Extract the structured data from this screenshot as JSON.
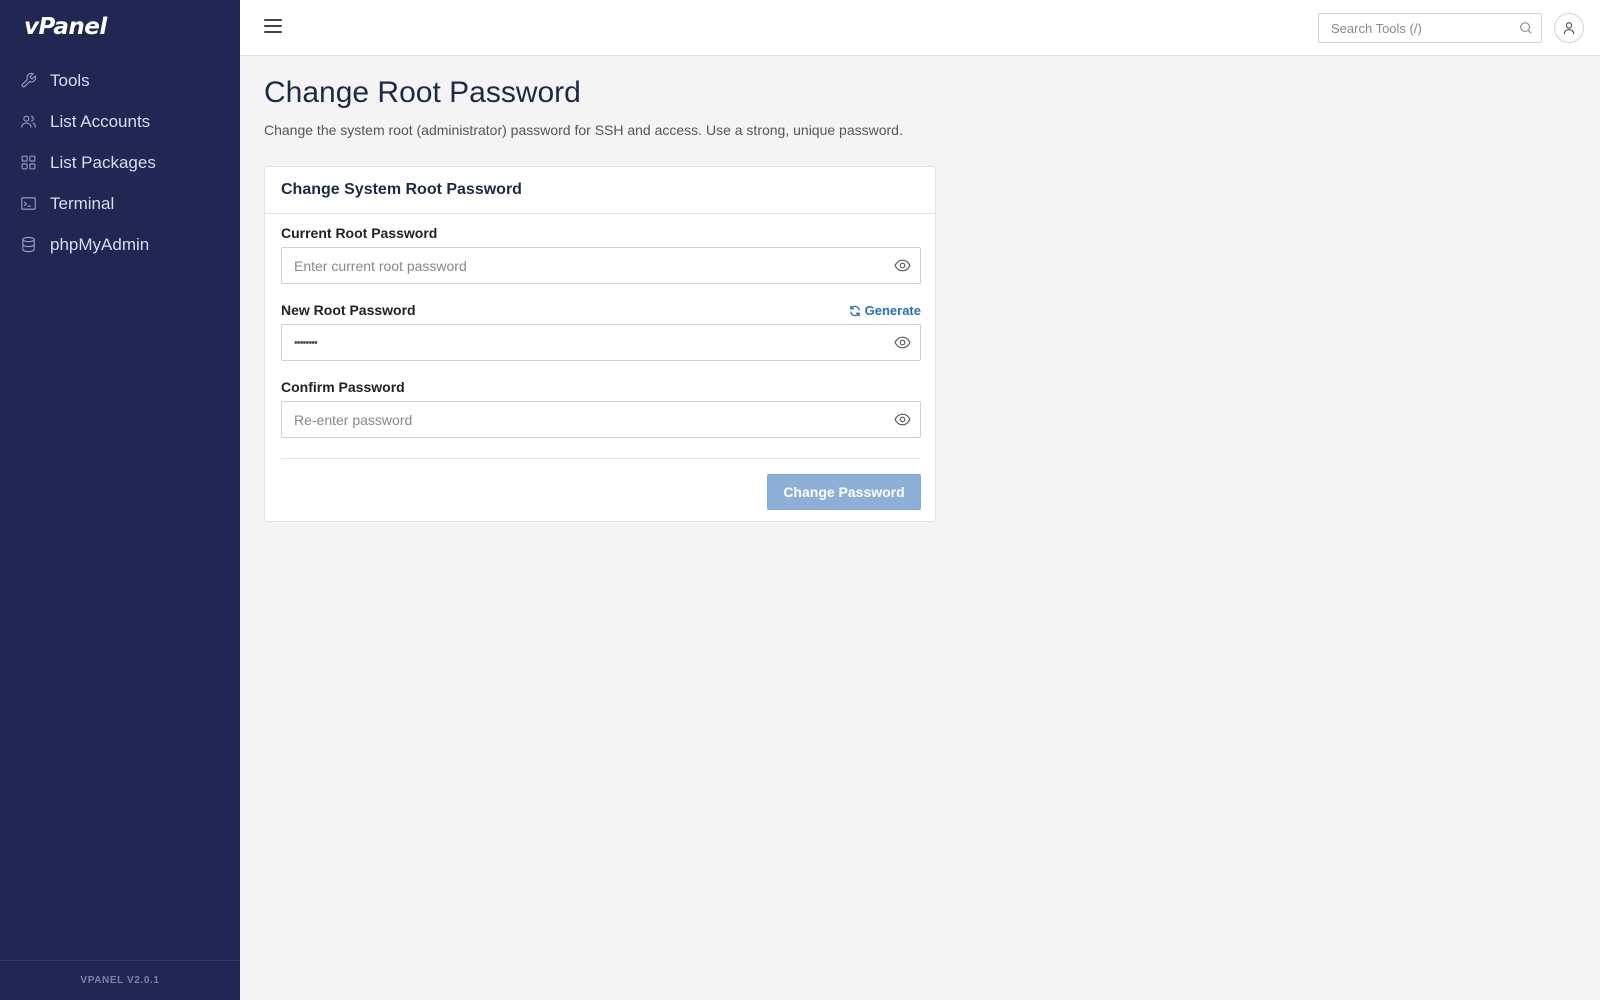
{
  "app": {
    "logo": "vPanel",
    "version": "VPANEL V2.0.1"
  },
  "sidebar": {
    "items": [
      {
        "label": "Tools",
        "icon": "wrench-icon"
      },
      {
        "label": "List Accounts",
        "icon": "users-icon"
      },
      {
        "label": "List Packages",
        "icon": "grid-icon"
      },
      {
        "label": "Terminal",
        "icon": "terminal-icon"
      },
      {
        "label": "phpMyAdmin",
        "icon": "database-icon"
      }
    ]
  },
  "header": {
    "search_placeholder": "Search Tools (/)"
  },
  "page": {
    "title": "Change Root Password",
    "description": "Change the system root (administrator) password for SSH and access. Use a strong, unique password."
  },
  "card": {
    "title": "Change System Root Password",
    "current": {
      "label": "Current Root Password",
      "placeholder": "Enter current root password",
      "value": ""
    },
    "new": {
      "label": "New Root Password",
      "generate_label": "Generate",
      "value": "••••••••"
    },
    "confirm": {
      "label": "Confirm Password",
      "placeholder": "Re-enter password",
      "value": ""
    },
    "submit_label": "Change Password"
  },
  "colors": {
    "sidebar_bg": "#212752",
    "accent": "#2a6fb6",
    "button_disabled": "#8fb0d6"
  }
}
